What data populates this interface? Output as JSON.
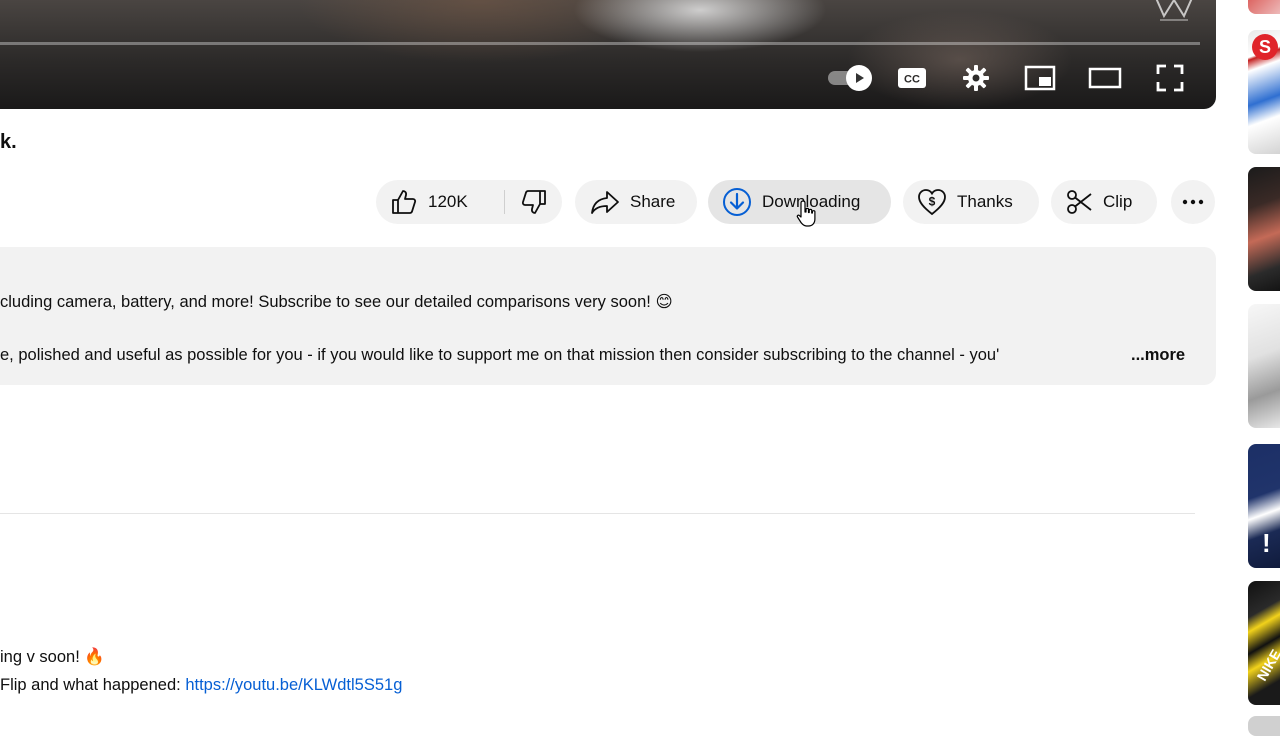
{
  "player": {
    "autoplay_on": true
  },
  "title_fragment": "k.",
  "actions": {
    "like_count": "120K",
    "share_label": "Share",
    "download_label": "Downloading",
    "thanks_label": "Thanks",
    "clip_label": "Clip"
  },
  "description": {
    "line1": "cluding camera, battery, and more! Subscribe to see our detailed comparisons very soon! 😊",
    "line2": "e, polished and useful as possible for you - if you would like to support me on that mission then consider subscribing to the channel - you'",
    "more_label": "...more"
  },
  "pinned": {
    "line1": "ing v soon! 🔥",
    "line2_prefix": "Flip and what happened: ",
    "line2_link": "https://youtu.be/KLWdtl5S51g"
  },
  "rail": {
    "thumb1_badge": "S",
    "thumb4_text": "!",
    "thumb5_text": "NIKE"
  },
  "colors": {
    "accent_link": "#065fd4",
    "download_icon": "#065fd4",
    "pill_bg": "#f2f2f2"
  }
}
